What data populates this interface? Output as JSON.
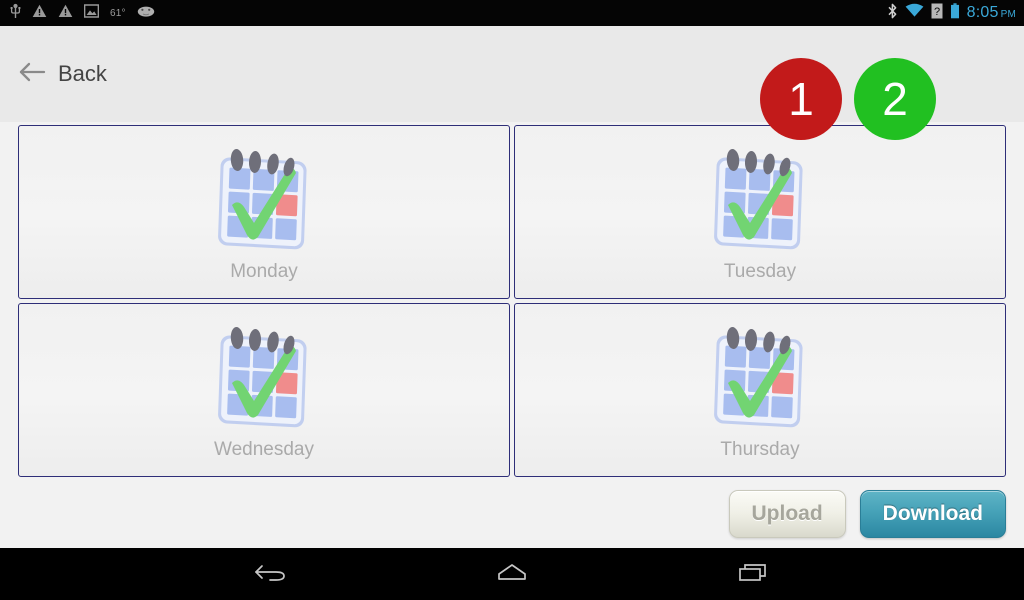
{
  "statusbar": {
    "left_icons": [
      {
        "name": "usb-icon"
      },
      {
        "name": "warning-triangle-icon"
      },
      {
        "name": "warning-triangle-icon-2"
      },
      {
        "name": "image-icon"
      }
    ],
    "temperature": "61°",
    "weather_icon": "cloud-icon",
    "right_icons": [
      {
        "name": "bluetooth-icon"
      },
      {
        "name": "wifi-icon"
      },
      {
        "name": "unknown-sim-icon"
      },
      {
        "name": "battery-icon"
      }
    ],
    "time": "8:05",
    "meridiem": "PM"
  },
  "header": {
    "back_label": "Back",
    "back_icon": "arrow-left-icon",
    "badges": [
      {
        "label": "1",
        "color": "#c21a1a"
      },
      {
        "label": "2",
        "color": "#21c021"
      }
    ]
  },
  "main": {
    "cards": [
      {
        "label": "Monday",
        "icon": "calendar-check-icon"
      },
      {
        "label": "Tuesday",
        "icon": "calendar-check-icon"
      },
      {
        "label": "Wednesday",
        "icon": "calendar-check-icon"
      },
      {
        "label": "Thursday",
        "icon": "calendar-check-icon"
      }
    ],
    "card_border_color": "#2e2e78",
    "label_color": "#aaaaaa"
  },
  "actions": {
    "upload_label": "Upload",
    "download_label": "Download",
    "upload_enabled": false,
    "download_accent": "#46a2b8"
  },
  "navbar": {
    "buttons": [
      {
        "name": "nav-back",
        "icon": "back-arrow-icon"
      },
      {
        "name": "nav-home",
        "icon": "home-icon"
      },
      {
        "name": "nav-recents",
        "icon": "recent-apps-icon"
      }
    ]
  }
}
